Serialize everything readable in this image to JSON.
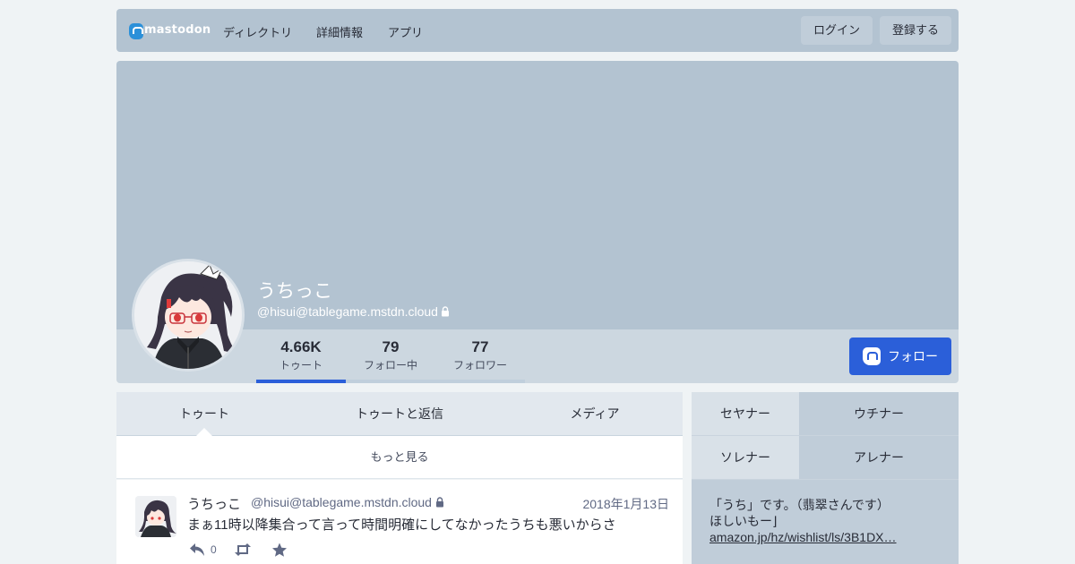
{
  "nav": {
    "logo_text": "mastodon",
    "links": [
      "ディレクトリ",
      "詳細情報",
      "アプリ"
    ],
    "login_label": "ログイン",
    "signup_label": "登録する"
  },
  "profile": {
    "display_name": "うちっこ",
    "acct": "@hisui@tablegame.mstdn.cloud",
    "locked": true,
    "follow_label": "フォロー",
    "counters": [
      {
        "value": "4.66K",
        "label": "トゥート",
        "active": true
      },
      {
        "value": "79",
        "label": "フォロー中",
        "active": false
      },
      {
        "value": "77",
        "label": "フォロワー",
        "active": false
      }
    ]
  },
  "tabs": [
    "トゥート",
    "トゥートと返信",
    "メディア"
  ],
  "load_more": "もっと見る",
  "status": {
    "name": "うちっこ",
    "acct": "@hisui@tablegame.mstdn.cloud",
    "time": "2018年1月13日",
    "content": "まぁ11時以降集合って言って時間明確にしてなかったうちも悪いからさ",
    "reply_count": "0"
  },
  "sidebar": {
    "tabs": [
      "セヤナー",
      "ウチナー",
      "ソレナー",
      "アレナー"
    ],
    "note_line1": "「うち」です。（翡翠さんです）",
    "note_line2": "ほしいもー⌋",
    "note_link": "amazon.jp/hz/wishlist/ls/3B1DX…"
  },
  "colors": {
    "accent": "#2b5fd9",
    "header_bg": "#b3c3d1",
    "page_bg": "#eff3f5"
  }
}
